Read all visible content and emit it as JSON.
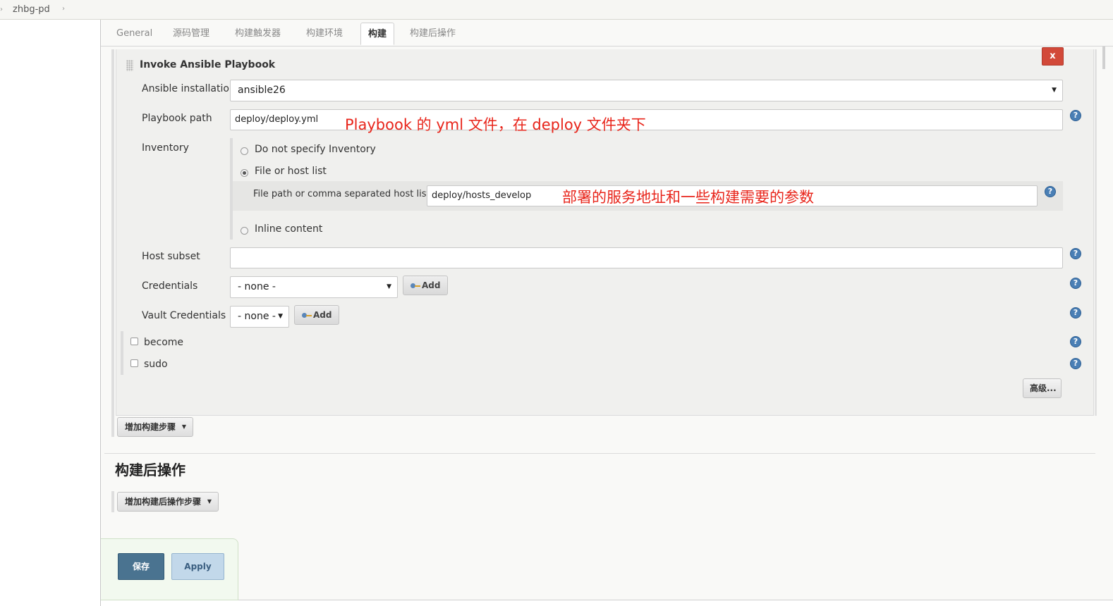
{
  "breadcrumb": {
    "job": "zhbg-pd",
    "separator": "›"
  },
  "tabs": [
    {
      "label": "General"
    },
    {
      "label": "源码管理"
    },
    {
      "label": "构建触发器"
    },
    {
      "label": "构建环境"
    },
    {
      "label": "构建",
      "active": true
    },
    {
      "label": "构建后操作"
    }
  ],
  "step": {
    "title": "Invoke Ansible Playbook",
    "delete_label": "x",
    "ansible_installation": {
      "label": "Ansible installation",
      "value": "ansible26"
    },
    "playbook_path": {
      "label": "Playbook path",
      "value": "deploy/deploy.yml"
    },
    "inventory": {
      "label": "Inventory",
      "options": [
        {
          "label": "Do not specify Inventory",
          "checked": false
        },
        {
          "label": "File or host list",
          "checked": true
        },
        {
          "label": "Inline content",
          "checked": false
        }
      ],
      "file_path": {
        "label": "File path or comma separated host list",
        "value": "deploy/hosts_develop"
      }
    },
    "host_subset": {
      "label": "Host subset",
      "value": ""
    },
    "credentials": {
      "label": "Credentials",
      "value": "- none -",
      "add_label": "Add"
    },
    "vault_credentials": {
      "label": "Vault Credentials",
      "value": "- none -",
      "add_label": "Add"
    },
    "become": {
      "label": "become",
      "checked": false
    },
    "sudo": {
      "label": "sudo",
      "checked": false
    },
    "advanced_label": "高级..."
  },
  "annotations": {
    "playbook": "Playbook 的 yml 文件，在 deploy 文件夹下",
    "hosts": "部署的服务地址和一些构建需要的参数"
  },
  "add_build_step_label": "增加构建步骤",
  "post_build": {
    "title": "构建后操作",
    "add_label": "增加构建后操作步骤"
  },
  "actions": {
    "save": "保存",
    "apply": "Apply"
  },
  "help_glyph": "?",
  "caret_glyph": "▼",
  "colors": {
    "delete": "#d24939",
    "save": "#4a7390",
    "apply": "#c2d8ea",
    "annotation": "#e8251b",
    "help": "#4a7fb5"
  }
}
